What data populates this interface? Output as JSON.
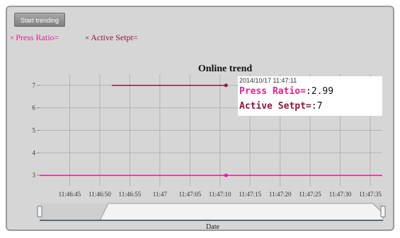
{
  "toolbar": {
    "start_button_label": "Start trending"
  },
  "legend": {
    "items": [
      {
        "marker": "×",
        "label": "Press Ratio=",
        "color": "#e0208f"
      },
      {
        "marker": "×",
        "label": "Active Setpt=",
        "color": "#8b1a3a"
      }
    ]
  },
  "tooltip": {
    "timestamp": "2014/10/17 11:47:11",
    "rows": [
      {
        "label": "Press Ratio=",
        "value": ":2.99",
        "color": "#e0208f"
      },
      {
        "label": "Active Setpt=",
        "value": ":7",
        "color": "#8b1a3a"
      }
    ]
  },
  "navigator": {
    "axis_label": "Date",
    "range_start_fraction": 0.2,
    "range_end_fraction": 0.97
  },
  "chart_data": {
    "type": "line",
    "title": "Online trend",
    "xlabel": "Date",
    "ylabel": "",
    "ylim": [
      2.5,
      7.5
    ],
    "y_ticks": [
      3,
      4,
      5,
      6,
      7
    ],
    "xlim": [
      "11:46:40",
      "11:47:37"
    ],
    "x_ticks": [
      "11:46:45",
      "11:46:50",
      "11:46:55",
      "11:47",
      "11:47:05",
      "11:47:10",
      "11:47:15",
      "11:47:20",
      "11:47:25",
      "11:47:30",
      "11:47:35"
    ],
    "grid": true,
    "series": [
      {
        "name": "Press Ratio",
        "color": "#e0208f",
        "x": [
          "11:46:40",
          "11:47:11",
          "11:47:37"
        ],
        "y": [
          2.99,
          2.99,
          2.99
        ],
        "highlight": {
          "x": "11:47:11",
          "y": 2.99
        }
      },
      {
        "name": "Active Setpt",
        "color": "#8b1a3a",
        "x": [
          "11:46:52",
          "11:47:11"
        ],
        "y": [
          7,
          7
        ],
        "highlight": {
          "x": "11:47:11",
          "y": 7
        }
      }
    ]
  }
}
